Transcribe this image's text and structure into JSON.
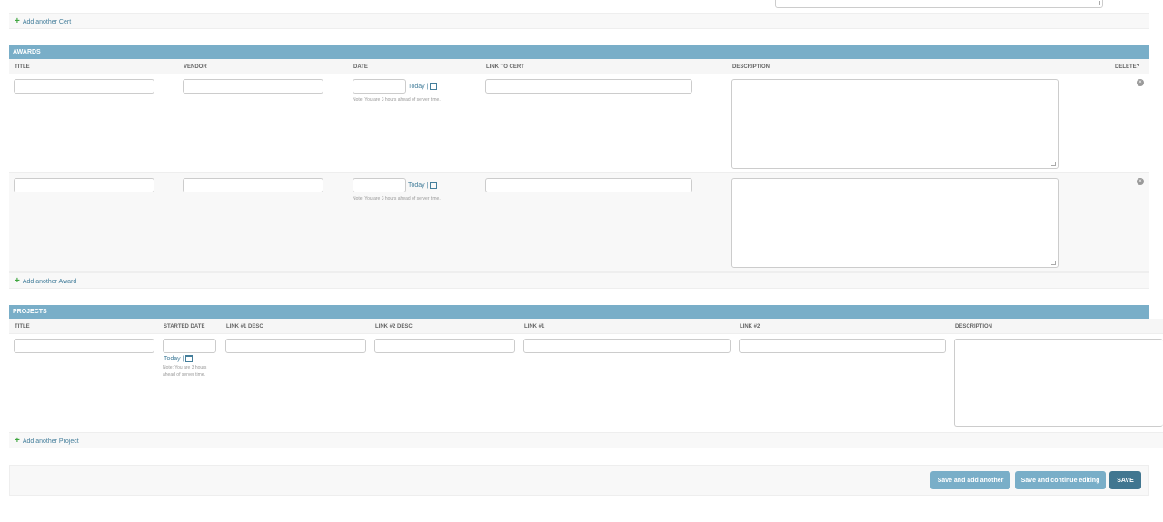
{
  "certs": {
    "add_label": "Add another Cert"
  },
  "awards": {
    "title": "AWARDS",
    "columns": {
      "title": "TITLE",
      "vendor": "VENDOR",
      "date": "DATE",
      "link": "LINK TO CERT",
      "description": "DESCRIPTION",
      "delete": "DELETE?"
    },
    "today_label": "Today |",
    "note": "Note: You are 3 hours ahead of server time.",
    "delete_icon": "×",
    "add_label": "Add another Award"
  },
  "projects": {
    "title": "PROJECTS",
    "columns": {
      "title": "TITLE",
      "started": "STARTED DATE",
      "link1desc": "LINK #1 DESC",
      "link2desc": "LINK #2 DESC",
      "link1": "LINK #1",
      "link2": "LINK #2",
      "description": "DESCRIPTION"
    },
    "today_label": "Today |",
    "note_line1": "Note: You are 3 hours",
    "note_line2": "ahead of server time.",
    "add_label": "Add another Project"
  },
  "submit": {
    "save_add": "Save and add another",
    "save_continue": "Save and continue editing",
    "save": "SAVE"
  }
}
